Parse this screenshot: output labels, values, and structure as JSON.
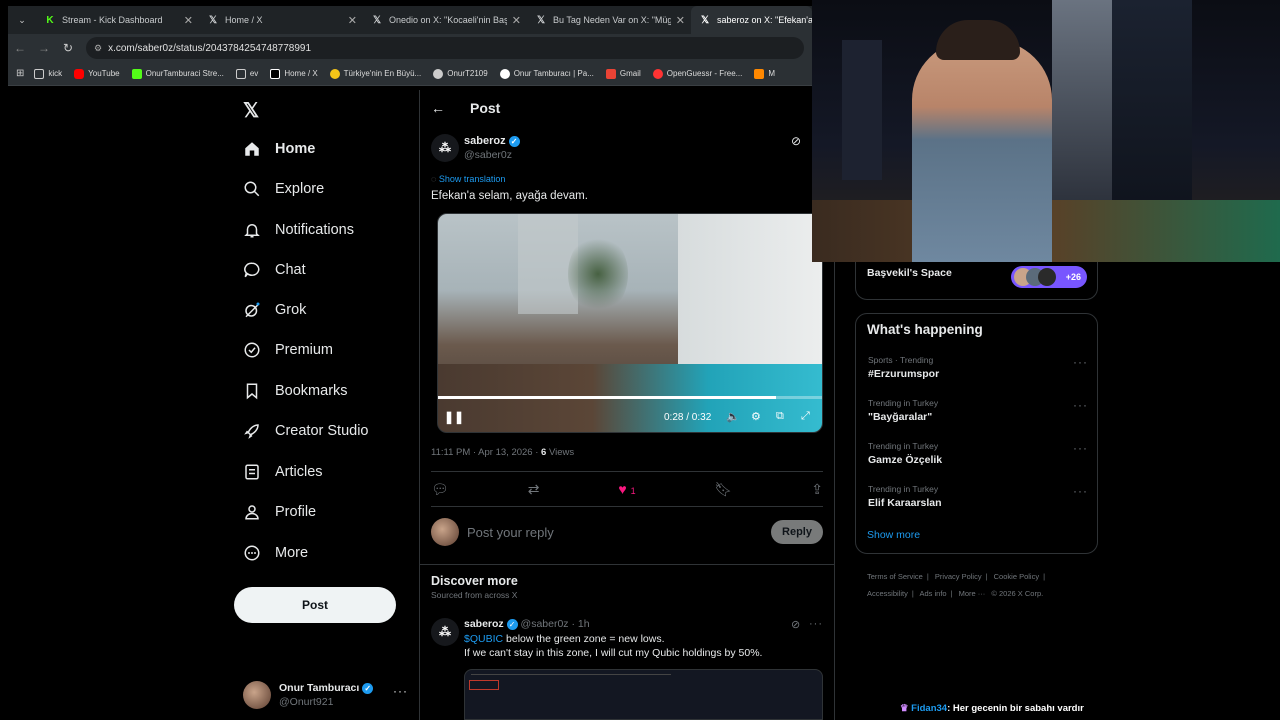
{
  "browser": {
    "tabs": [
      {
        "title": "Stream - Kick Dashboard",
        "icon": "kick-icon",
        "color": "#53fc18"
      },
      {
        "title": "Home / X",
        "icon": "x-icon",
        "color": "#ffffff"
      },
      {
        "title": "Onedio on X: \"Kocaeli'nin Başın",
        "icon": "x-icon",
        "color": "#ffffff"
      },
      {
        "title": "Bu Tag Neden Var on X: \"Müge",
        "icon": "x-icon",
        "color": "#ffffff"
      },
      {
        "title": "saberoz on X: \"Efekan'a se",
        "icon": "x-icon",
        "color": "#ffffff",
        "active": true
      }
    ],
    "url": "x.com/saber0z/status/2043784254748778991",
    "bookmarks": [
      {
        "label": "kick",
        "color": "#e0e0e0"
      },
      {
        "label": "YouTube",
        "color": "#ff0000"
      },
      {
        "label": "OnurTamburaci Stre...",
        "color": "#53fc18"
      },
      {
        "label": "ev",
        "color": "#c8c8c8"
      },
      {
        "label": "Home / X",
        "color": "#ffffff"
      },
      {
        "label": "Türkiye'nin En Büyü...",
        "color": "#f5c518"
      },
      {
        "label": "OnurT2109",
        "color": "#cccccc"
      },
      {
        "label": "Onur Tamburacı | Pa...",
        "color": "#ffffff"
      },
      {
        "label": "Gmail",
        "color": "#ea4335"
      },
      {
        "label": "OpenGuessr - Free...",
        "color": "#ff3333"
      },
      {
        "label": "M",
        "color": "#ff8800"
      }
    ]
  },
  "sidebar": {
    "items": [
      {
        "label": "Home",
        "icon": "home-icon"
      },
      {
        "label": "Explore",
        "icon": "search-icon"
      },
      {
        "label": "Notifications",
        "icon": "bell-icon"
      },
      {
        "label": "Chat",
        "icon": "chat-icon"
      },
      {
        "label": "Grok",
        "icon": "grok-icon"
      },
      {
        "label": "Premium",
        "icon": "premium-icon"
      },
      {
        "label": "Bookmarks",
        "icon": "bookmark-icon"
      },
      {
        "label": "Creator Studio",
        "icon": "rocket-icon"
      },
      {
        "label": "Articles",
        "icon": "article-icon"
      },
      {
        "label": "Profile",
        "icon": "person-icon"
      },
      {
        "label": "More",
        "icon": "more-circle-icon"
      }
    ],
    "post_button": "Post",
    "account": {
      "name": "Onur Tamburacı",
      "handle": "@Onurt921"
    }
  },
  "post": {
    "header": "Post",
    "author_name": "saberoz",
    "author_handle": "@saber0z",
    "show_translation": "Show translation",
    "text": "Efekan'a selam, ayağa devam.",
    "video_time": "0:28 / 0:32",
    "video_progress": 0.875,
    "timestamp": "11:11 PM · Apr 13, 2026 · ",
    "views_count": "6",
    "views_label": "Views",
    "like_count": "1",
    "reply_placeholder": "Post your reply",
    "reply_button": "Reply"
  },
  "discover": {
    "title": "Discover more",
    "subtitle": "Sourced from across X",
    "tweet": {
      "author_name": "saberoz",
      "meta": "@saber0z · 1h",
      "ticker": "$QUBIC",
      "line1_rest": " below the green zone = new lows.",
      "line2": "If we can't stay in this zone, I will cut my Qubic holdings by 50%."
    }
  },
  "right": {
    "space_title": "Başvekil's Space",
    "space_count": "+26",
    "happening_title": "What's happening",
    "trends": [
      {
        "category": "Sports · Trending",
        "name": "#Erzurumspor"
      },
      {
        "category": "Trending in Turkey",
        "name": "\"Bayğaralar\""
      },
      {
        "category": "Trending in Turkey",
        "name": "Gamze Özçelik"
      },
      {
        "category": "Trending in Turkey",
        "name": "Elif Karaarslan"
      }
    ],
    "show_more": "Show more",
    "footer": [
      "Terms of Service",
      "|",
      "Privacy Policy",
      "|",
      "Cookie Policy",
      "|",
      "Accessibility",
      "|",
      "Ads info",
      "|",
      "More ···",
      "© 2026 X Corp."
    ]
  },
  "chat": {
    "user": "Fidan34",
    "message": ": Her gecenin bir sabahı vardır"
  }
}
